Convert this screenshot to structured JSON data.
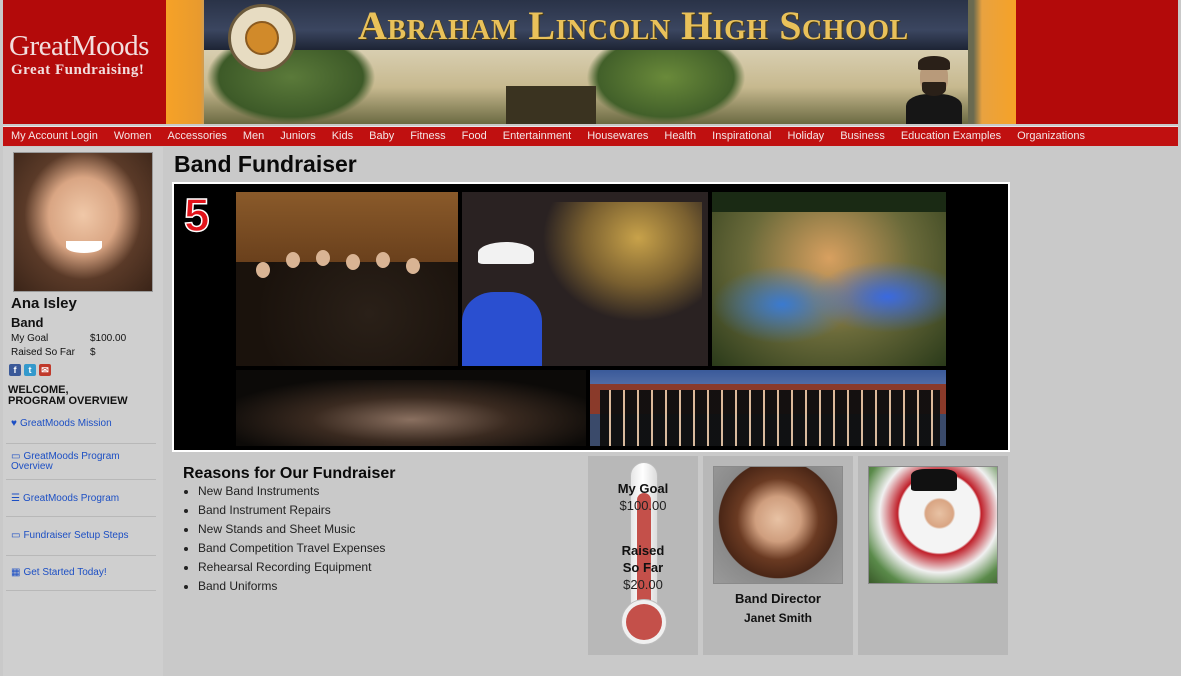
{
  "brand": {
    "logo_main": "GreatMoods",
    "logo_tagline": "Great Fundraising!"
  },
  "banner": {
    "school_name": "Abraham Lincoln High School",
    "seal_text": "LINCOLN HIGH SCHOOL LOS ANGELES, CALIFORNIA"
  },
  "nav": {
    "items": [
      "My Account Login",
      "Women",
      "Accessories",
      "Men",
      "Juniors",
      "Kids",
      "Baby",
      "Fitness",
      "Food",
      "Entertainment",
      "Housewares",
      "Health",
      "Inspirational",
      "Holiday",
      "Business",
      "Education Examples",
      "Organizations"
    ]
  },
  "profile": {
    "name": "Ana Isley",
    "group": "Band",
    "goal_label": "My Goal",
    "goal_value": "$100.00",
    "raised_label": "Raised So Far",
    "raised_value": "$",
    "social_icons": [
      "facebook-icon",
      "twitter-icon",
      "email-icon"
    ],
    "welcome_line1": "WELCOME,",
    "welcome_line2": "PROGRAM OVERVIEW"
  },
  "sidebar_links": [
    {
      "icon": "heart-icon",
      "label": "GreatMoods Mission"
    },
    {
      "icon": "monitor-icon",
      "label": "GreatMoods Program Overview"
    },
    {
      "icon": "list-icon",
      "label": "GreatMoods Program"
    },
    {
      "icon": "monitor-icon",
      "label": "Fundraiser Setup Steps"
    },
    {
      "icon": "calendar-icon",
      "label": "Get Started Today!"
    }
  ],
  "main": {
    "title": "Band Fundraiser",
    "collage_number": "5",
    "reasons_title": "Reasons for Our Fundraiser",
    "reasons": [
      "New Band Instruments",
      "Band Instrument Repairs",
      "New Stands and Sheet Music",
      "Band Competition Travel Expenses",
      "Rehearsal Recording Equipment",
      "Band Uniforms"
    ]
  },
  "thermometer": {
    "goal_label": "My Goal",
    "goal_value": "$100.00",
    "raised_label_line1": "Raised",
    "raised_label_line2": "So Far",
    "raised_value": "$20.00",
    "fill_fraction": 0.2
  },
  "director": {
    "title": "Band Director",
    "name": "Janet Smith"
  },
  "colors": {
    "brand_red": "#b30a0a",
    "nav_red": "#c01010",
    "link_blue": "#1c4fc4",
    "thermo_red": "#c4504a"
  }
}
